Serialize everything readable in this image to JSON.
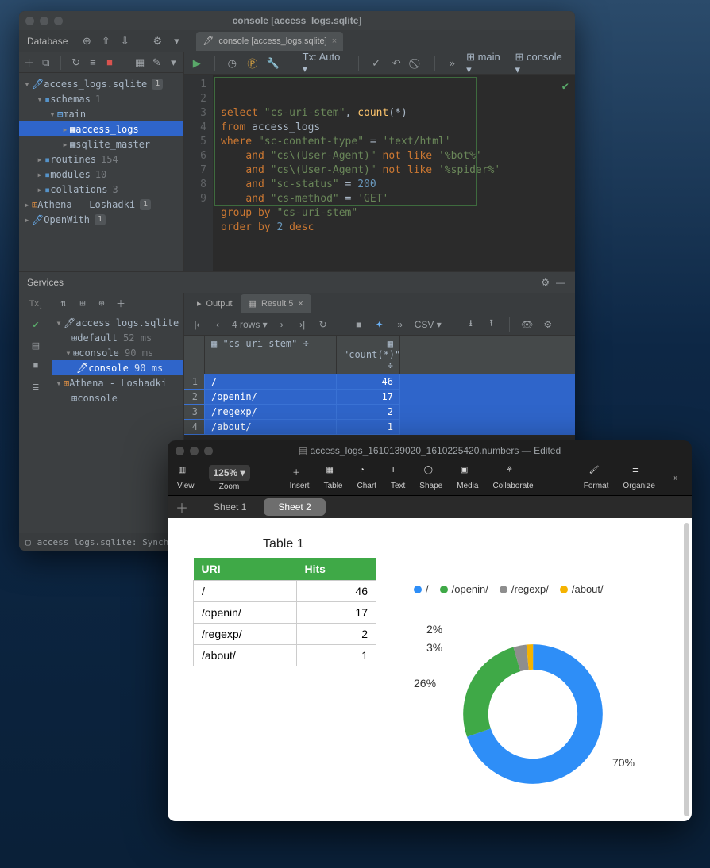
{
  "datagrip": {
    "title": "console [access_logs.sqlite]",
    "sidebar_label": "Database",
    "editor_tab": "console [access_logs.sqlite]",
    "tx_mode": "Tx: Auto",
    "schema_sel": "main",
    "console_sel": "console",
    "tree": {
      "db": "access_logs.sqlite",
      "db_badge": "1",
      "schemas": "schemas",
      "schemas_badge": "1",
      "main": "main",
      "t1": "access_logs",
      "t2": "sqlite_master",
      "routines": "routines",
      "routines_badge": "154",
      "modules": "modules",
      "modules_badge": "10",
      "collations": "collations",
      "collations_badge": "3",
      "athena": "Athena - Loshadki",
      "athena_badge": "1",
      "openwith": "OpenWith",
      "openwith_badge": "1"
    },
    "code": {
      "l1a": "select",
      "l1b": "\"cs-uri-stem\"",
      "l1c": ", ",
      "l1d": "count",
      "l1e": "(*)",
      "l2a": "from",
      "l2b": " access_logs",
      "l3a": "where",
      "l3b": "\"sc-content-type\"",
      "l3c": " = ",
      "l3d": "'text/html'",
      "l4a": "and",
      "l4b": "\"cs\\(User-Agent)\"",
      "l4c": "not like",
      "l4d": "'%bot%'",
      "l5a": "and",
      "l5b": "\"cs\\(User-Agent)\"",
      "l5c": "not like",
      "l5d": "'%spider%'",
      "l6a": "and",
      "l6b": "\"sc-status\"",
      "l6c": " = ",
      "l6d": "200",
      "l7a": "and",
      "l7b": "\"cs-method\"",
      "l7c": " = ",
      "l7d": "'GET'",
      "l8a": "group by",
      "l8b": "\"cs-uri-stem\"",
      "l9a": "order by",
      "l9b": "2",
      "l9c": "desc"
    },
    "services": {
      "label": "Services",
      "tree": {
        "db": "access_logs.sqlite",
        "default": "default",
        "default_ms": "52 ms",
        "console1": "console",
        "console1_ms": "90 ms",
        "console2": "console",
        "console2_ms": "90 ms",
        "athena": "Athena - Loshadki",
        "console3": "console"
      },
      "tabs": {
        "output": "Output",
        "result": "Result 5"
      },
      "rows_label": "4 rows",
      "export_fmt": "CSV",
      "headers": {
        "c1": "\"cs-uri-stem\"",
        "c2": "\"count(*)\""
      },
      "rows": [
        {
          "n": "1",
          "uri": "/",
          "cnt": "46"
        },
        {
          "n": "2",
          "uri": "/openin/",
          "cnt": "17"
        },
        {
          "n": "3",
          "uri": "/regexp/",
          "cnt": "2"
        },
        {
          "n": "4",
          "uri": "/about/",
          "cnt": "1"
        }
      ]
    },
    "status": "access_logs.sqlite: Synchro"
  },
  "numbers": {
    "title": "access_logs_1610139020_1610225420.numbers — Edited",
    "zoom": "125%",
    "tools": {
      "view": "View",
      "zoom": "Zoom",
      "insert": "Insert",
      "table": "Table",
      "chart": "Chart",
      "text": "Text",
      "shape": "Shape",
      "media": "Media",
      "collab": "Collaborate",
      "format": "Format",
      "organize": "Organize"
    },
    "tabs": {
      "s1": "Sheet 1",
      "s2": "Sheet 2"
    },
    "table_title": "Table 1",
    "headers": {
      "uri": "URI",
      "hits": "Hits"
    },
    "rows": [
      {
        "uri": "/",
        "hits": "46"
      },
      {
        "uri": "/openin/",
        "hits": "17"
      },
      {
        "uri": "/regexp/",
        "hits": "2"
      },
      {
        "uri": "/about/",
        "hits": "1"
      }
    ],
    "legend": {
      "a": "/",
      "b": "/openin/",
      "c": "/regexp/",
      "d": "/about/"
    },
    "labels": {
      "p70": "70%",
      "p26": "26%",
      "p3": "3%",
      "p2": "2%"
    }
  },
  "chart_data": {
    "type": "pie",
    "title": "Table 1",
    "categories": [
      "/",
      "/openin/",
      "/regexp/",
      "/about/"
    ],
    "values": [
      46,
      17,
      2,
      1
    ],
    "percentages": [
      70,
      26,
      3,
      2
    ],
    "colors": [
      "#2e8ef7",
      "#3fa947",
      "#8e8e8e",
      "#f5b301"
    ],
    "legend_position": "top"
  }
}
